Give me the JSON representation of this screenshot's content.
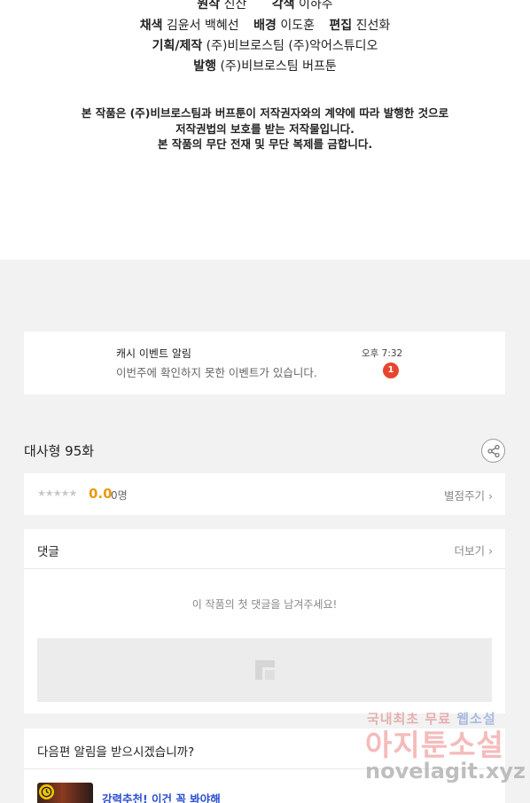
{
  "credits": {
    "line1": {
      "label1": "원작",
      "value1": "신산",
      "label2": "각색",
      "value2": "이하주"
    },
    "line2": {
      "label1": "채색",
      "value1": "김윤서  백혜선",
      "label2": "배경",
      "value2": "이도훈",
      "label3": "편집",
      "value3": "진선화"
    },
    "line3": {
      "label": "기획/제작",
      "value": "(주)비브로스팀  (주)악어스튜디오"
    },
    "line4": {
      "label": "발행",
      "value": "(주)비브로스팀  버프툰"
    },
    "notice": [
      "본 작품은 (주)비브로스팀과 버프툰이 저작권자와의 계약에 따라 발행한 것으로",
      "저작권법의 보호를 받는 저작물입니다.",
      "본 작품의 무단 전재 및 무단 복제를 금합니다."
    ]
  },
  "event": {
    "title": "캐시 이벤트 알림",
    "message": "이번주에 확인하지 못한 이벤트가 있습니다.",
    "time": "오후 7:32",
    "badge": "1",
    "badge_color": "#e8452e"
  },
  "episode": {
    "title": "대사형 95화",
    "share_icon": "share-icon"
  },
  "rating": {
    "stars": "★★★★★",
    "stars_filled": 0,
    "score": "0.0",
    "count": "0명",
    "rate_link": "별점주기 ›",
    "score_color": "#e89b12"
  },
  "comments": {
    "label": "댓글",
    "more_link": "더보기 ›",
    "empty_text": "이 작품의 첫 댓글을 남겨주세요!"
  },
  "notify": {
    "question": "다음편 알림을 받으시겠습니까?",
    "rec_title": "강력추천! 이건 꼭 봐야해",
    "rec_title_color": "#2a4fd0"
  },
  "watermark": {
    "line1_a": "국내최초 무료 ",
    "line1_b": "웹소설",
    "line2": "아지툰소설",
    "line3": "novelagit.xyz"
  }
}
